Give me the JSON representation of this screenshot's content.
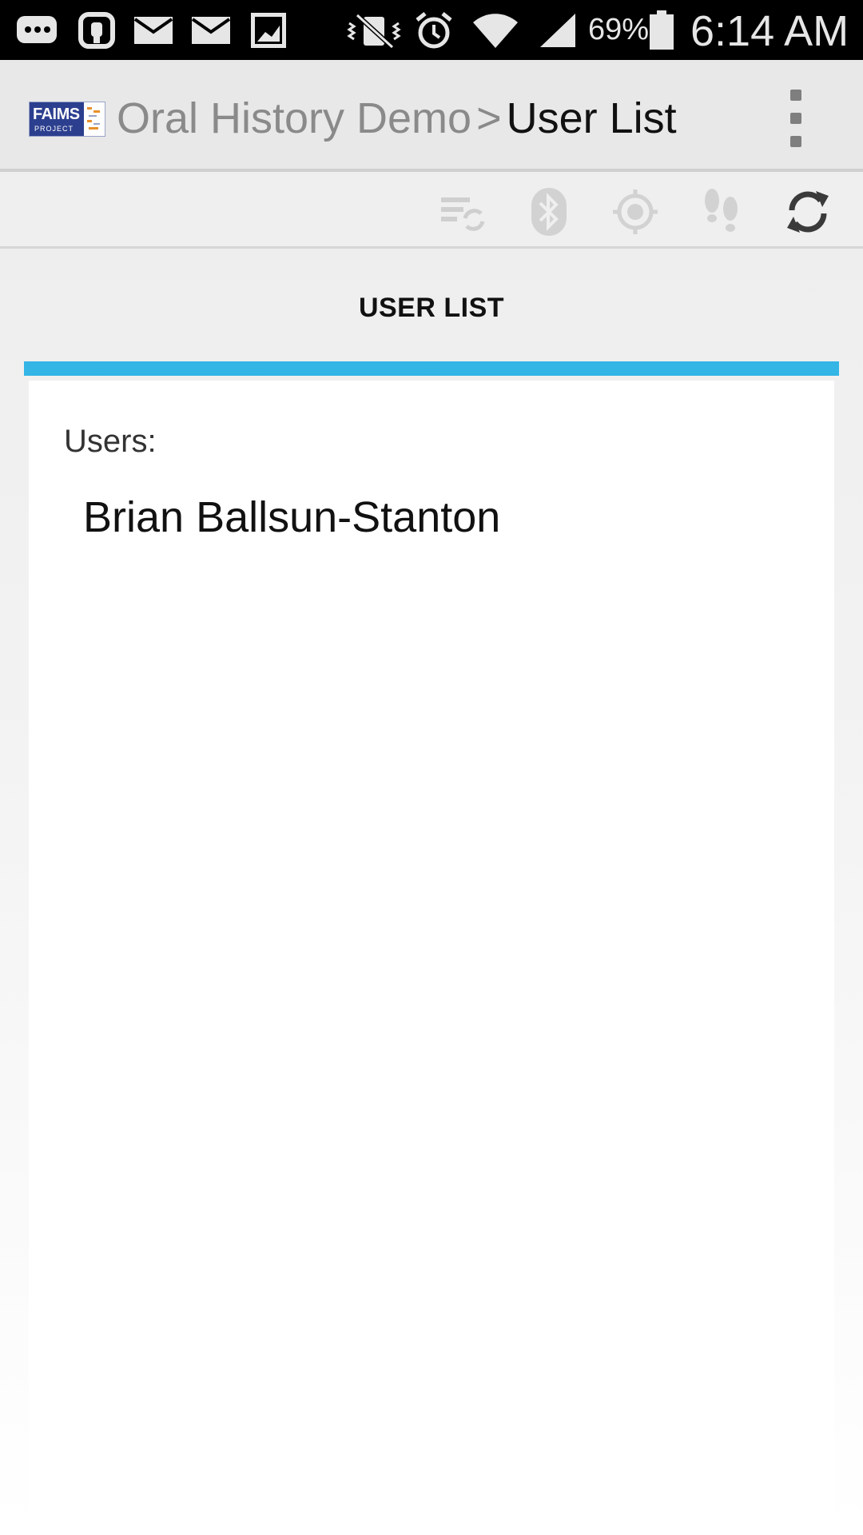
{
  "status_bar": {
    "battery_percent": "69%",
    "time": "6:14 AM",
    "icons": [
      "messages-icon",
      "voicemail-icon",
      "mail-icon",
      "mail-icon",
      "gallery-icon",
      "vibrate-off-icon",
      "alarm-icon",
      "wifi-icon",
      "signal-icon",
      "battery-icon"
    ]
  },
  "action_bar": {
    "logo_text": "FAIMS",
    "logo_subtext": "PROJECT",
    "app_name": "Oral History Demo",
    "separator": ">",
    "page_name": "User List",
    "overflow_icon": "overflow-menu-icon"
  },
  "toolbar": {
    "icons": [
      "sync-file-icon",
      "bluetooth-icon",
      "gps-icon",
      "tracking-footsteps-icon",
      "refresh-icon"
    ]
  },
  "tab": {
    "label": "USER LIST",
    "indicator_color": "#33b5e5"
  },
  "content": {
    "users_label": "Users:",
    "users": [
      "Brian Ballsun-Stanton"
    ]
  }
}
